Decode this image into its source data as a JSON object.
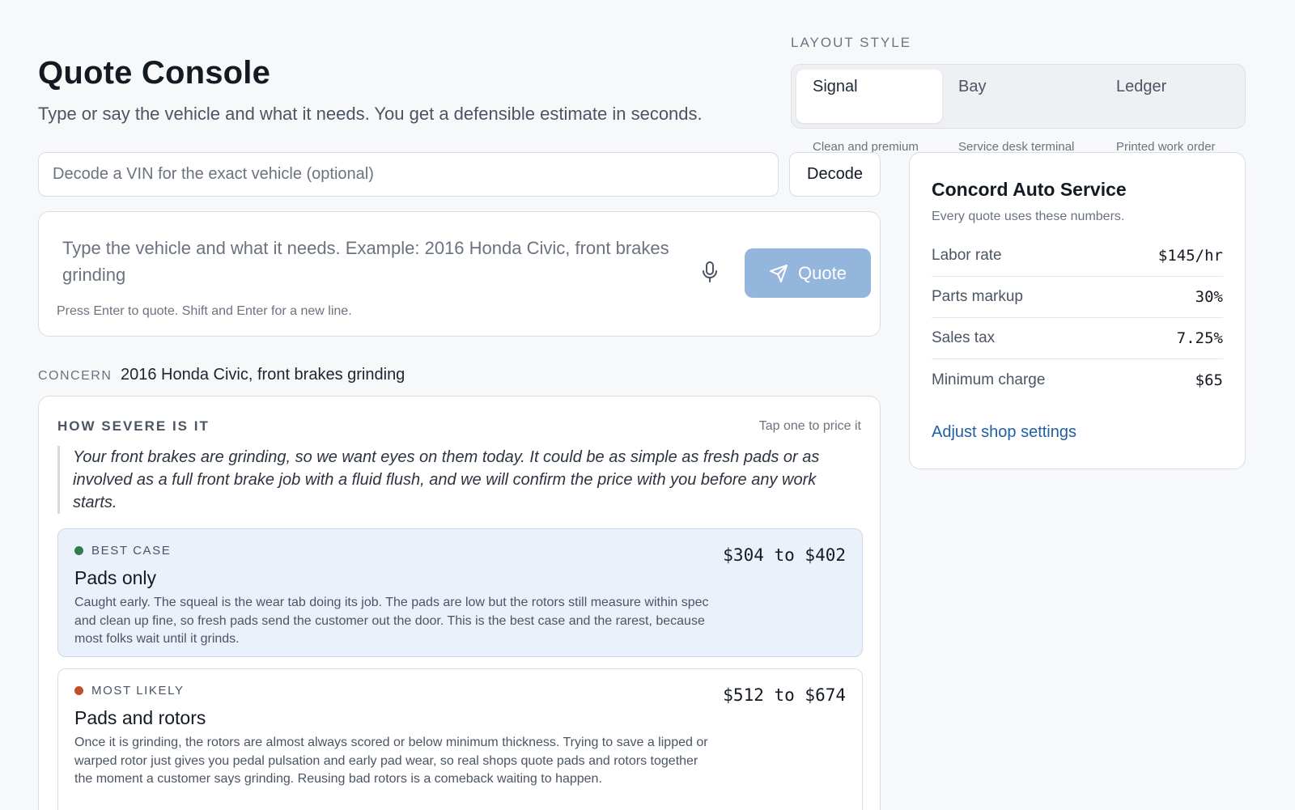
{
  "header": {
    "title": "Quote Console",
    "subtitle": "Type or say the vehicle and what it needs. You get a defensible estimate in seconds."
  },
  "layout_style": {
    "label": "LAYOUT STYLE",
    "options": [
      {
        "name": "Signal",
        "desc": "Clean and premium",
        "active": true
      },
      {
        "name": "Bay",
        "desc": "Service desk terminal",
        "active": false
      },
      {
        "name": "Ledger",
        "desc": "Printed work order",
        "active": false
      }
    ]
  },
  "vin": {
    "placeholder": "Decode a VIN for the exact vehicle (optional)",
    "value": "",
    "decode_label": "Decode"
  },
  "query": {
    "placeholder": "Type the vehicle and what it needs. Example: 2016 Honda Civic, front brakes grinding",
    "quote_label": "Quote",
    "hint": "Press Enter to quote. Shift and Enter for a new line.",
    "mic_icon": "microphone-icon",
    "send_icon": "send-icon"
  },
  "concern": {
    "label": "CONCERN",
    "value": "2016 Honda Civic, front brakes grinding"
  },
  "severity": {
    "title": "HOW SEVERE IS IT",
    "hint": "Tap one to price it",
    "summary": "Your front brakes are grinding, so we want eyes on them today. It could be as simple as fresh pads or as involved as a full front brake job with a fluid flush, and we will confirm the price with you before any work starts.",
    "options": [
      {
        "tier": "BEST CASE",
        "dot_color": "#2e7d4f",
        "title": "Pads only",
        "price": "$304 to $402",
        "desc": "Caught early. The squeal is the wear tab doing its job. The pads are low but the rotors still measure within spec and clean up fine, so fresh pads send the customer out the door. This is the best case and the rarest, because most folks wait until it grinds.",
        "selected": true
      },
      {
        "tier": "MOST LIKELY",
        "dot_color": "#c0502a",
        "title": "Pads and rotors",
        "price": "$512 to $674",
        "desc": "Once it is grinding, the rotors are almost always scored or below minimum thickness. Trying to save a lipped or warped rotor just gives you pedal pulsation and early pad wear, so real shops quote pads and rotors together the moment a customer says grinding. Reusing bad rotors is a comeback waiting to happen.",
        "selected": false
      }
    ]
  },
  "shop": {
    "name": "Concord Auto Service",
    "subtitle": "Every quote uses these numbers.",
    "rows": [
      {
        "label": "Labor rate",
        "value": "$145/hr"
      },
      {
        "label": "Parts markup",
        "value": "30%"
      },
      {
        "label": "Sales tax",
        "value": "7.25%"
      },
      {
        "label": "Minimum charge",
        "value": "$65"
      }
    ],
    "link": "Adjust shop settings",
    "accent": "#1f5fa3"
  }
}
